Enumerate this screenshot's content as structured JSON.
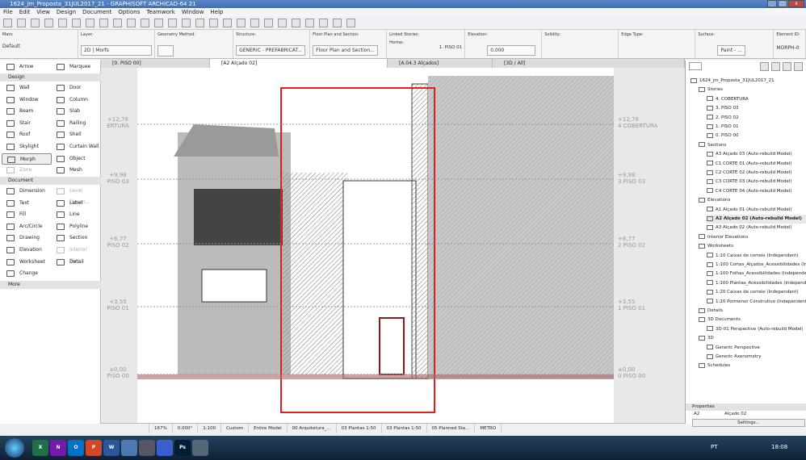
{
  "window": {
    "title": "1624_jm_Proposta_31JUL2017_21 - GRAPHISOFT ARCHICAD-64 21"
  },
  "menu": [
    "File",
    "Edit",
    "View",
    "Design",
    "Document",
    "Options",
    "Teamwork",
    "Window",
    "Help"
  ],
  "infobox": {
    "main_label": "Main:",
    "main_value": "Default",
    "layer_label": "Layer:",
    "layer_value": "2D | Morfs",
    "geometry_label": "Geometry Method:",
    "structure_label": "Structure:",
    "structure_value": "GENERIC - PREFABRICAT...",
    "floorplan_label": "Floor Plan and Section:",
    "floorplan_value": "Floor Plan and Section...",
    "linked_label": "Linked Stories:",
    "linked_home": "Home:",
    "linked_value": "1. PISO 01",
    "elevation_label": "Elevation:",
    "elevation_value": "0,000",
    "solidity_label": "Solidity:",
    "edge_label": "Edge Type:",
    "surface_label": "Surface:",
    "surface_value": "Paint - ...",
    "element_id_label": "Element ID:",
    "element_id_value": "MORPH-0"
  },
  "tabs": [
    {
      "label": "[0. PISO 00]"
    },
    {
      "label": "[A2 Alçado 02]",
      "active": true
    },
    {
      "label": "[A.04.3 Alçados]"
    },
    {
      "label": "[3D / All]"
    }
  ],
  "toolbox": {
    "arrow": "Arrow",
    "marquee": "Marquee",
    "design_header": "Design",
    "design": [
      "Wall",
      "Door",
      "Window",
      "Column",
      "Beam",
      "Slab",
      "Stair",
      "Railing",
      "Roof",
      "Shell",
      "Skylight",
      "Curtain Wall",
      "Morph",
      "Object",
      "Zone",
      "Mesh"
    ],
    "document_header": "Document",
    "document": [
      "Dimension",
      "Level Dimen...",
      "Text",
      "Label",
      "Fill",
      "Line",
      "Arc/Circle",
      "Polyline",
      "Drawing",
      "Section",
      "Elevation",
      "Interior Elev...",
      "Worksheet",
      "Detail",
      "Change"
    ],
    "more_header": "More"
  },
  "levels": [
    {
      "value": "+12,78",
      "left": "ERTURA",
      "right": "4 COBERTURA"
    },
    {
      "value": "+9,98",
      "left": "PISO 03",
      "right": "3 PISO 03"
    },
    {
      "value": "+6,77",
      "left": "PISO 02",
      "right": "2 PISO 02"
    },
    {
      "value": "+3,55",
      "left": "PISO 01",
      "right": "1 PISO 01"
    },
    {
      "value": "±0,00",
      "left": "PISO 00",
      "right": "0 PISO 00"
    }
  ],
  "navigator": {
    "items": [
      "1624_jm_Proposta_31JUL2017_21",
      "Stories",
      "4. COBERTURA",
      "3. PISO 03",
      "2. PISO 02",
      "1. PISO 01",
      "0. PISO 00",
      "Sections",
      "A3 Alçado 03 (Auto-rebuild Model)",
      "C1 CORTE 01 (Auto-rebuild Model)",
      "C2 CORTE 02 (Auto-rebuild Model)",
      "C3 CORTE 03 (Auto-rebuild Model)",
      "C4 CORTE 04 (Auto-rebuild Model)",
      "Elevations",
      "A1 Alçado 01 (Auto-rebuild Model)",
      "A2 Alçado 02 (Auto-rebuild Model)",
      "A3 Alçado 02 (Auto-rebuild Model)",
      "Interior Elevations",
      "Worksheets",
      "1:10 Caixas de correio (Independent)",
      "1:100 Cortes_Alçados_Acessibilidades (Ind",
      "1:100 Folhas_Acessibilidades (Independer",
      "1:100 Plantas_Acessibilidades (Independe",
      "1:20 Caixas de correio (Independent)",
      "1:20 Pormenor Construtivo (Independent)",
      "Details",
      "3D Documents",
      "3D-01 Perspective (Auto-rebuild Model)",
      "3D",
      "Generic Perspective",
      "Generic Axonometry",
      "Schedules"
    ],
    "properties_header": "Properties",
    "prop_id": "A2",
    "prop_name": "Alçado 02",
    "settings": "Settings..."
  },
  "statusbar": [
    "167%",
    "0,000°",
    "1:100",
    "Custom",
    "Entire Model",
    "00 Arquitetura_...",
    "03 Plantas 1:50",
    "03 Plantas 1:50",
    "05 Planned Sta...",
    "METRO"
  ],
  "taskbar": {
    "apps": [
      "X",
      "N",
      "O",
      "P",
      "W",
      "",
      "",
      "",
      "Ps",
      ""
    ],
    "lang": "PT",
    "time": "18:08"
  },
  "colors": {
    "highlight": "#e02020",
    "title": "#3b6fb5"
  }
}
